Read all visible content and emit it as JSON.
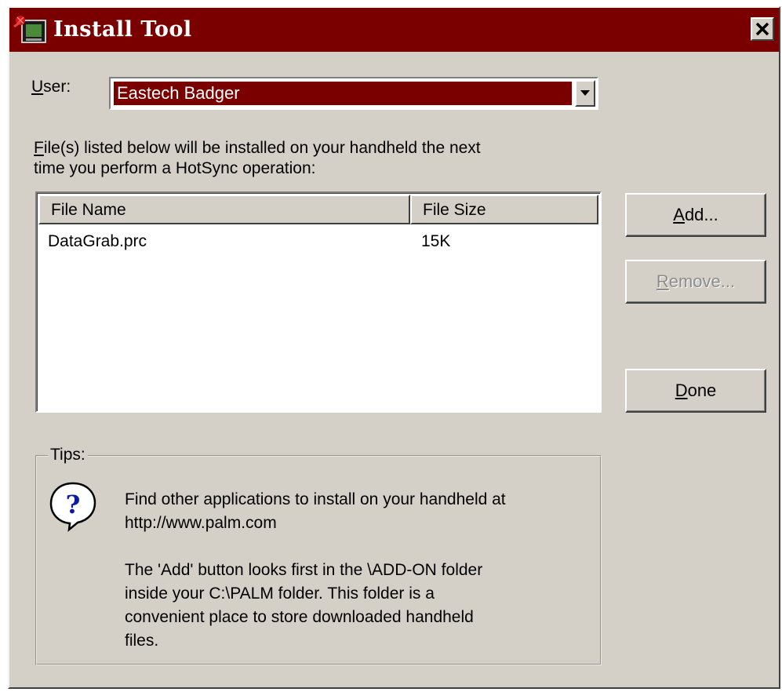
{
  "window": {
    "title": "Install Tool",
    "close_label": "X"
  },
  "user": {
    "label_mnemonic": "U",
    "label_rest": "ser:",
    "selected": "Eastech Badger"
  },
  "instructions": {
    "line1_mnemonic": "F",
    "line1_rest": "ile(s) listed below will be installed on your handheld the next",
    "line2": "time you perform a HotSync operation:"
  },
  "file_list": {
    "columns": [
      "File Name",
      "File Size"
    ],
    "rows": [
      {
        "name": "DataGrab.prc",
        "size": "15K"
      }
    ]
  },
  "buttons": {
    "add": {
      "mnemonic": "A",
      "rest": "dd...",
      "enabled": true
    },
    "remove": {
      "mnemonic": "R",
      "rest": "emove...",
      "enabled": false
    },
    "done": {
      "mnemonic": "D",
      "rest": "one",
      "enabled": true
    }
  },
  "tips": {
    "title": "Tips:",
    "icon": "help-balloon-icon",
    "tip1": [
      "Find other applications to install on your handheld at",
      "http://www.palm.com"
    ],
    "tip2": [
      "The 'Add' button looks first in the \\ADD-ON folder",
      "inside your C:\\PALM folder. This folder is a",
      "convenient place to store downloaded handheld",
      "files."
    ]
  },
  "colors": {
    "titlebar": "#7a0000",
    "selection": "#7a0000",
    "face": "#d4d0c8"
  }
}
